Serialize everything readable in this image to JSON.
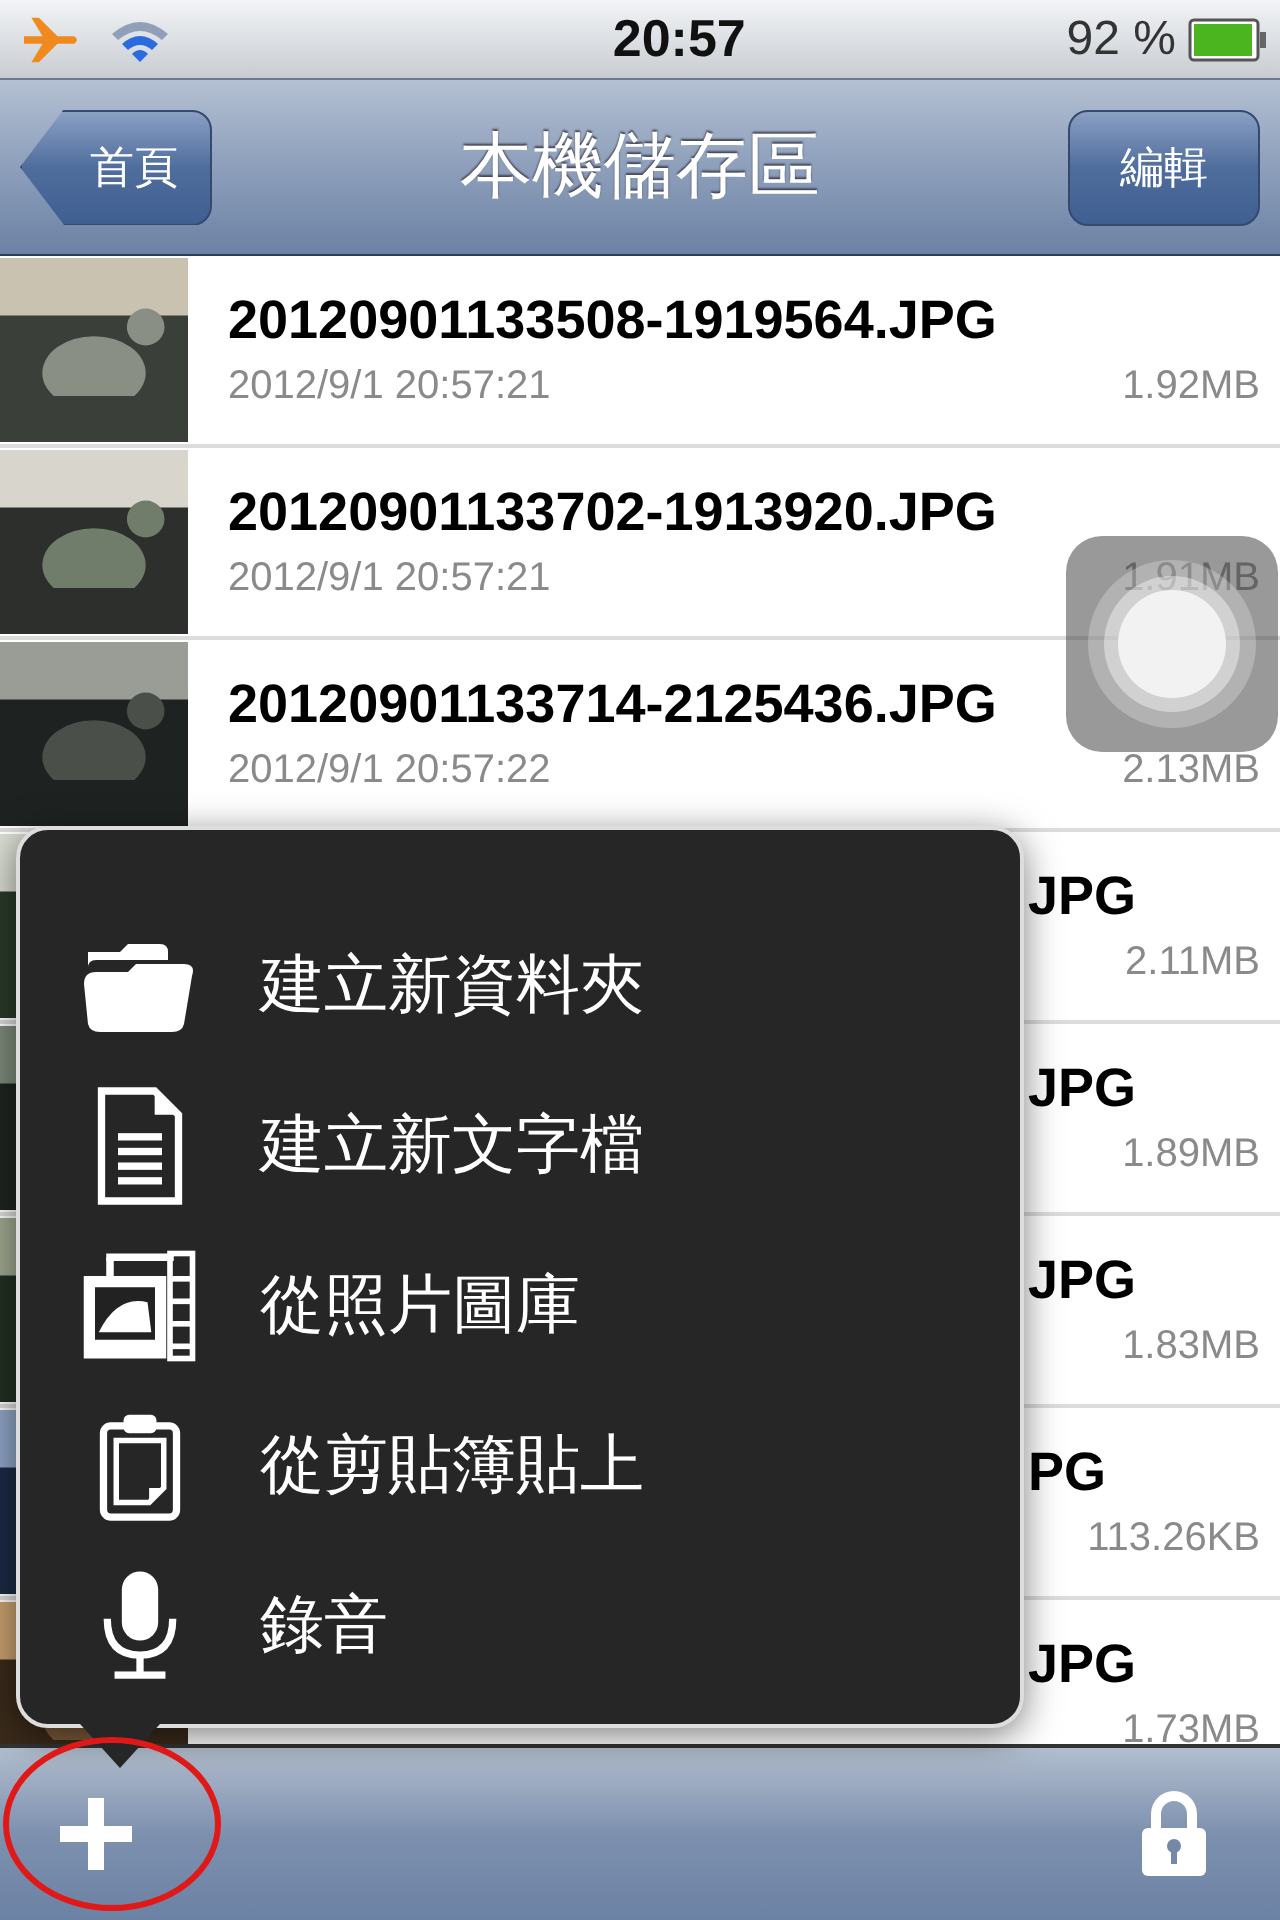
{
  "status_bar": {
    "time": "20:57",
    "battery": "92 %"
  },
  "nav_bar": {
    "back_button": "首頁",
    "title": "本機儲存區",
    "edit_button": "編輯"
  },
  "files": [
    {
      "kind": "full",
      "name": "20120901133508-1919564.JPG",
      "date": "2012/9/1 20:57:21",
      "size": "1.92MB"
    },
    {
      "kind": "full",
      "name": "20120901133702-1913920.JPG",
      "date": "2012/9/1 20:57:21",
      "size": "1.91MB"
    },
    {
      "kind": "full",
      "name": "20120901133714-2125436.JPG",
      "date": "2012/9/1 20:57:22",
      "size": "2.13MB"
    },
    {
      "kind": "covered",
      "name": "JPG",
      "size": "2.11MB"
    },
    {
      "kind": "covered",
      "name": "JPG",
      "size": "1.89MB"
    },
    {
      "kind": "covered",
      "name": "JPG",
      "size": "1.83MB"
    },
    {
      "kind": "covered",
      "name": "PG",
      "size": "113.26KB"
    },
    {
      "kind": "covered",
      "name": "JPG",
      "size": "1.73MB"
    }
  ],
  "add_menu": {
    "items": [
      {
        "label": "建立新資料夾",
        "kind": "folder"
      },
      {
        "label": "建立新文字檔",
        "kind": "document"
      },
      {
        "label": "從照片圖庫",
        "kind": "photos"
      },
      {
        "label": "從剪貼簿貼上",
        "kind": "clipboard"
      },
      {
        "label": "錄音",
        "kind": "microphone"
      }
    ]
  }
}
